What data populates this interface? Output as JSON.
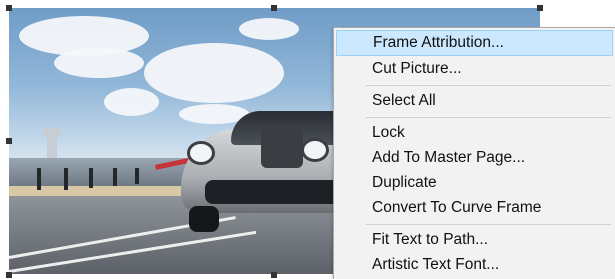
{
  "context_menu": {
    "highlight_color": "#cce8ff",
    "groups": [
      {
        "items": [
          {
            "label": "Frame Attribution...",
            "highlighted": true
          },
          {
            "label": "Cut Picture..."
          }
        ]
      },
      {
        "items": [
          {
            "label": "Select All"
          }
        ]
      },
      {
        "items": [
          {
            "label": "Lock"
          },
          {
            "label": "Add To Master Page..."
          },
          {
            "label": "Duplicate"
          },
          {
            "label": "Convert To Curve Frame"
          }
        ]
      },
      {
        "items": [
          {
            "label": "Fit Text to Path..."
          },
          {
            "label": "Artistic Text Font..."
          }
        ]
      }
    ]
  },
  "picture": {
    "subject": "sports-car-on-racetrack",
    "selected": true
  }
}
